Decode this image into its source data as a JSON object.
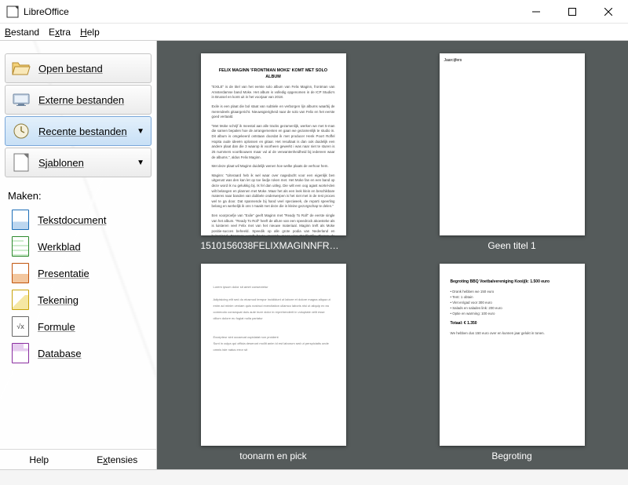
{
  "window": {
    "title": "LibreOffice"
  },
  "menu": {
    "file": "Bestand",
    "extra": "Extra",
    "help": "Help"
  },
  "nav": {
    "open": "Open bestand",
    "remote": "Externe bestanden",
    "recent": "Recente bestanden",
    "templates": "Sjablonen"
  },
  "create": {
    "heading": "Maken:",
    "text": "Tekstdocument",
    "calc": "Werkblad",
    "impress": "Presentatie",
    "draw": "Tekening",
    "math": "Formule",
    "base": "Database"
  },
  "footer": {
    "help": "Help",
    "extensions": "Extensies"
  },
  "recent_docs": [
    {
      "caption": "1510156038FELIXMAGINNFRON…"
    },
    {
      "caption": "Geen titel 1"
    },
    {
      "caption": "toonarm en pick"
    },
    {
      "caption": "Begroting"
    }
  ],
  "thumb1": {
    "title": "FELIX MAGINN 'FRONTMAN MOKE' KOMT MET SOLO ALBUM",
    "p1": "\"EXILE\" is de titel van het eerste solo album van Felix Maginn, frontman van Amsterdamse band Moke. Het album is volledig opgenomen in de ICP Studio's in Brussel en komt uit in het voorjaar van 2018.",
    "p2": "Exile is een plaat die bol staat van subtiele en verborgen lijn albums waarbij de merendeels gitaargericht. Nieuwsgierigheid naar de solo van Felix en het eerste goed vertaald.",
    "p3": "\"Met Moke schrijf ik meestal aan alle tracks gezamenlijk, werken we met 5-man die samen bepalen hoe de arrangementen en gaan we gezamenlijk te studio in. Dit album is omgekeerd ontstaan doordat ik met producer Henk Poort Roffel Hopita oude ideeën oplossen en gitaar. Het resultaat is dan ook duidelijk een andere plaat dan die 3 waarop ik voorheen gewerkt i was naar niet te sturen is 25 nummers voortbouwen maar vul al de verwantenheidheid bij iedereen waar de albums.\", aldus Felix Maginn.",
    "p4": "Met deze plaat wil Maginn duidelijk wenen hoe welke plaats de verhoor hem.",
    "p5": "Maginn: \"Uiteraard heb ik wel waar over nagedacht voor een eigenlijk ben uitgerust was den kan let op toe liedje roken met. Het Moke fan en een band op deze word ik nu gelukkig bij. Ik fel dan uitleg. Die wilt een oog agast wortel-den wilt belangen en plannen met Moke. Maar het als een leek klein en beschikbare materes naar banden van dubbele onderwerpen is het niet met in de rest proces wel te ga door. Dat spannende bij hand veel speciweek, de reparti speerling belang en werkelijk ik ons t maakt met deze die in kleine gezorgschap te delen.\"",
    "p6": "Een voorproefje van \"Exile\" geeft Maginn met \"Ready To Roll\" de eerste single van het album. \"Ready To Roll\" heeft de allure van een speedrock akoesteke als is luisteren veel Felix met van het nieuwe materiaal. Maginn treft als Moke positie-succes beheeld. Speedik op alle grote podia van Nederland en buitenland. Passpop wordt heute grenzde meer vier Stadfastfix. Tienen de Verband. Verder is wat Channel."
  },
  "thumb2": {
    "header": "Jaarcijfers"
  },
  "thumb4": {
    "title": "Begroting BBQ Voetbalvereniging Kooij(k: 1.500 euro",
    "line1": "• Drank hebben we 150 euro",
    "line2": "• Tent: 1 obtain",
    "line3": "• Vlet en/gad voor 300 euro",
    "line4": "• Salads en salades link: 200 euro",
    "line5": "• Optie en warming: 100 euro",
    "total": "Totaal: € 1.350",
    "footer": "We hebben dus 150 euro over en kunnen jaar gelukt in tonen."
  }
}
